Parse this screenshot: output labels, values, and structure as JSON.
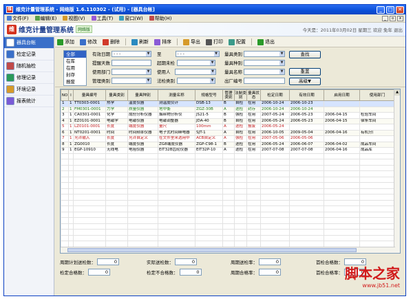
{
  "window": {
    "title": "维克计量管理系统 - 网络版 1.6.110302 - (试用) - [器具台帐]",
    "app_icon": "维"
  },
  "menu": [
    {
      "label": "文件(F)",
      "color": "#4a7fd6"
    },
    {
      "label": "编辑(E)",
      "color": "#5aa04a"
    },
    {
      "label": "视图(V)",
      "color": "#d69a2a"
    },
    {
      "label": "工具(T)",
      "color": "#9a5ad6"
    },
    {
      "label": "窗口(W)",
      "color": "#3aa0c0"
    },
    {
      "label": "帮助(H)",
      "color": "#c04a4a"
    }
  ],
  "header": {
    "logo": "维",
    "product_name": "维克计量管理系统",
    "edition_badge": "网络版",
    "date_info": "今天是：2011年03月02日 星期三  欢迎   免年   退出"
  },
  "sidebar": [
    {
      "label": "器具台帐",
      "color": "#ffffff"
    },
    {
      "label": "检定记录",
      "color": "#3a6fc9"
    },
    {
      "label": "随机抽检",
      "color": "#c04a4a"
    },
    {
      "label": "修理记录",
      "color": "#2a9a5a"
    },
    {
      "label": "环境记录",
      "color": "#d69a2a"
    },
    {
      "label": "报表统计",
      "color": "#7a5ad6"
    }
  ],
  "toolbar": [
    {
      "label": "添加",
      "color": "#2a9a2a"
    },
    {
      "label": "修改",
      "color": "#3a6fc9"
    },
    {
      "label": "删除",
      "color": "#d13a2a"
    },
    {
      "label": "刷新",
      "color": "#2a8ac0"
    },
    {
      "label": "排序",
      "color": "#8a5ad6"
    },
    {
      "label": "导出",
      "color": "#d69a2a"
    },
    {
      "label": "打印",
      "color": "#555555"
    },
    {
      "label": "配置",
      "color": "#3a9a8a"
    },
    {
      "label": "退出",
      "color": "#2a9a2a"
    }
  ],
  "status_list": [
    "全部",
    "在库",
    "在用",
    "封存",
    "报废"
  ],
  "filters": {
    "valid_date_label": "有效日期",
    "valid_date_from": "- - -",
    "to_label": "至",
    "valid_date_to": "- - -",
    "category_label": "量具类别",
    "remind_days_label": "提醒天数",
    "overdue_label": "超期未检",
    "type_label": "量具种别",
    "dept_label": "使用部门",
    "user_label": "使用人",
    "name_label": "量具名称",
    "mgmt_label": "管理类别",
    "method_label": "法检类别",
    "factory_no_label": "出厂编号"
  },
  "actions": {
    "search": "查找",
    "reset": "重置",
    "advanced": "高级▼"
  },
  "table": {
    "headers": [
      "NO",
      "I",
      "量具编号",
      "量具类别",
      "量具种别",
      "测量名称",
      "规格型号",
      "管理类别",
      "法制类别",
      "量具状态",
      "检定日期",
      "有效日期",
      "启用日期",
      "使用部门"
    ],
    "rows": [
      {
        "cells": [
          "1",
          "1",
          "TT0303-0001",
          "热学",
          "温度仪器",
          "测温度仪计",
          "DSB-13",
          "B",
          "自检",
          "在用",
          "2006-10-24",
          "2006-10-23",
          "",
          ""
        ],
        "color": "#000000",
        "sel": true
      },
      {
        "cells": [
          "2",
          "1",
          "FM0301-0001",
          "力学",
          "质量仪器",
          "地中衡",
          "ZGZ-30B",
          "A",
          "送检",
          "封存",
          "2006-10-24",
          "2006-10-24",
          "",
          ""
        ],
        "color": "#1d7a1d",
        "sel": false
      },
      {
        "cells": [
          "3",
          "1",
          "CA0301-0001",
          "化学",
          "成份分析仪器",
          "烟丝物分析仪",
          "JS21-5",
          "B",
          "强检",
          "在用",
          "2007-05-24",
          "2006-05-23",
          "2006-04-15",
          "检验车间"
        ],
        "color": "#000000",
        "sel": false
      },
      {
        "cells": [
          "4",
          "1",
          "EZ0101-0001",
          "电磁学",
          "电磁仪器",
          "电磁调整器",
          "JDA-40",
          "B",
          "自检",
          "在用",
          "2006-05-24",
          "2006-05-23",
          "2006-04-15",
          "宿条车间"
        ],
        "color": "#000000",
        "sel": false
      },
      {
        "cells": [
          "5",
          "1",
          "LZ0101-0001",
          "长度",
          "端度仪器",
          "量尺",
          "100mm",
          "A",
          "送检",
          "报废",
          "2006-05-24",
          "",
          "",
          ""
        ],
        "color": "#c01a1a",
        "sel": false
      },
      {
        "cells": [
          "6",
          "1",
          "NT0201-0001",
          "时间",
          "时间频率仪器",
          "电子式时间继电器",
          "SJT-1",
          "A",
          "自检",
          "在用",
          "2006-10-05",
          "2009-05-04",
          "2006-04-16",
          "有机分厂"
        ],
        "color": "#000000",
        "sel": false
      },
      {
        "cells": [
          "7",
          "1",
          "允许输入",
          "长度",
          "允许自定义",
          "在文件里来选用中",
          "ACB自定义",
          "A",
          "强检",
          "在用",
          "2007-05-06",
          "2006-05-06",
          "",
          ""
        ],
        "color": "#c01a1a",
        "sel": false
      },
      {
        "cells": [
          "8",
          "1",
          "ZG0010",
          "长度",
          "端度仪器",
          "ZG8端度仪器",
          "ZGP-C98-1",
          "B",
          "送检",
          "在用",
          "2006-05-24",
          "2006-06-07",
          "2006-04-02",
          "成品车间"
        ],
        "color": "#000000",
        "sel": false
      },
      {
        "cells": [
          "9",
          "1",
          "EGP-10910",
          "无线电",
          "电阻仪器",
          "EIT32B齿轮仪器",
          "EIT32P-10",
          "A",
          "送检",
          "在用",
          "2007-07-08",
          "2007-07-08",
          "2006-04-16",
          "成品库"
        ],
        "color": "#000000",
        "sel": false
      }
    ]
  },
  "stats": [
    {
      "label": "周期计划送检数：",
      "value": "0"
    },
    {
      "label": "实际送检数：",
      "value": "0"
    },
    {
      "label": "周期送检率：",
      "value": "0"
    },
    {
      "label": "首检合格数：",
      "value": "0"
    },
    {
      "label": "检定合格数：",
      "value": "0"
    },
    {
      "label": "检定不合格数：",
      "value": "0"
    },
    {
      "label": "周期合格率：",
      "value": "0"
    },
    {
      "label": "首检合格率：",
      "value": "0"
    }
  ],
  "watermark": {
    "text": "脚本之家",
    "url": "www.jb51.net"
  }
}
